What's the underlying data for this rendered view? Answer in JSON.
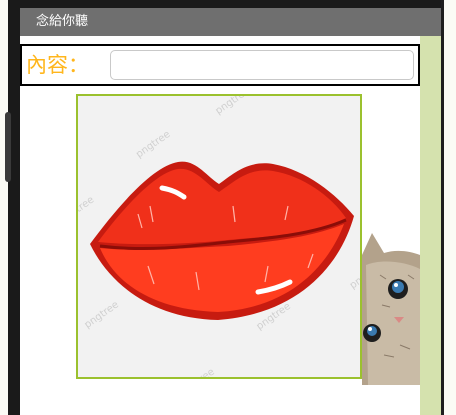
{
  "app": {
    "title": "念給你聽"
  },
  "input": {
    "label": "內容：",
    "value": "",
    "placeholder": ""
  },
  "image": {
    "name": "lips-image",
    "watermark": "pngtree"
  },
  "colors": {
    "label": "#ffb61c",
    "frame": "#9bc12e",
    "titlebar": "#6f6f6f",
    "strip": "#d5e2ae"
  }
}
